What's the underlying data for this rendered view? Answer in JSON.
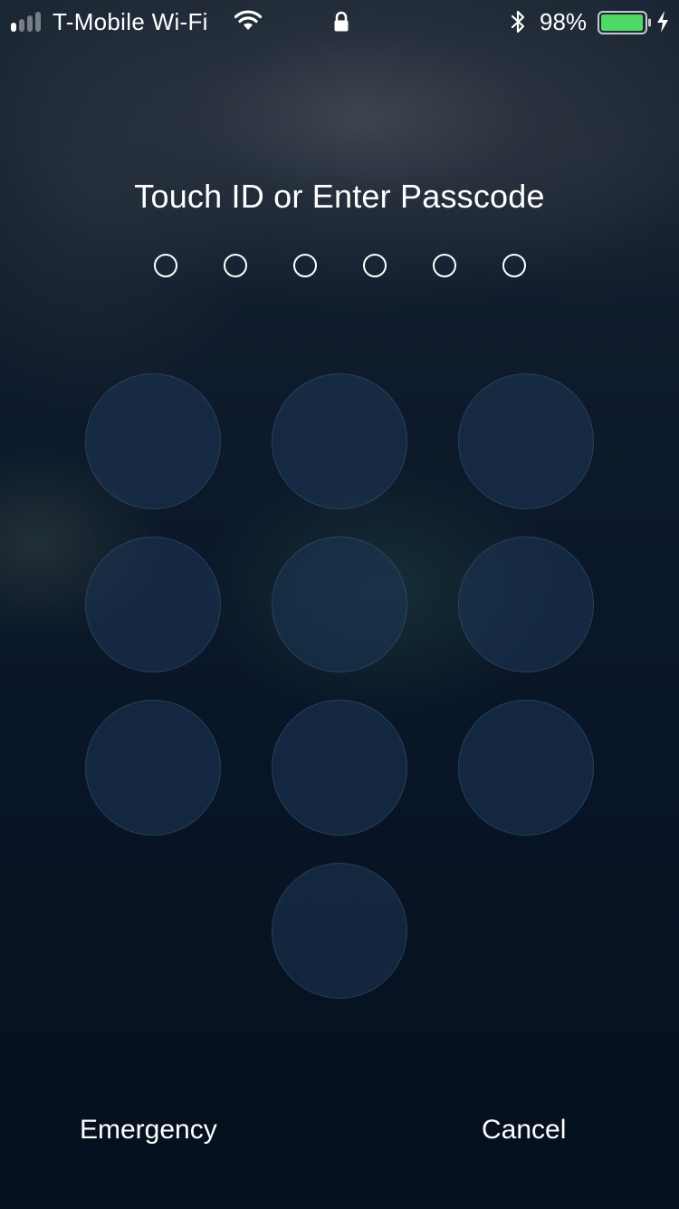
{
  "status_bar": {
    "carrier": "T-Mobile Wi-Fi",
    "battery_percent": "98%",
    "signal_bars_active": 1,
    "signal_bars_total": 4,
    "battery_level": 0.98,
    "battery_color": "#4cd964",
    "icons": [
      "signal-icon",
      "wifi-icon",
      "lock-icon",
      "bluetooth-icon",
      "battery-icon",
      "charging-icon"
    ]
  },
  "passcode": {
    "title": "Touch ID or Enter Passcode",
    "digit_count": 6,
    "entered_count": 0
  },
  "keypad": {
    "key_count": 10,
    "key_labels": [
      "",
      "",
      "",
      "",
      "",
      "",
      "",
      "",
      "",
      ""
    ]
  },
  "buttons": {
    "emergency_label": "Emergency",
    "cancel_label": "Cancel"
  }
}
